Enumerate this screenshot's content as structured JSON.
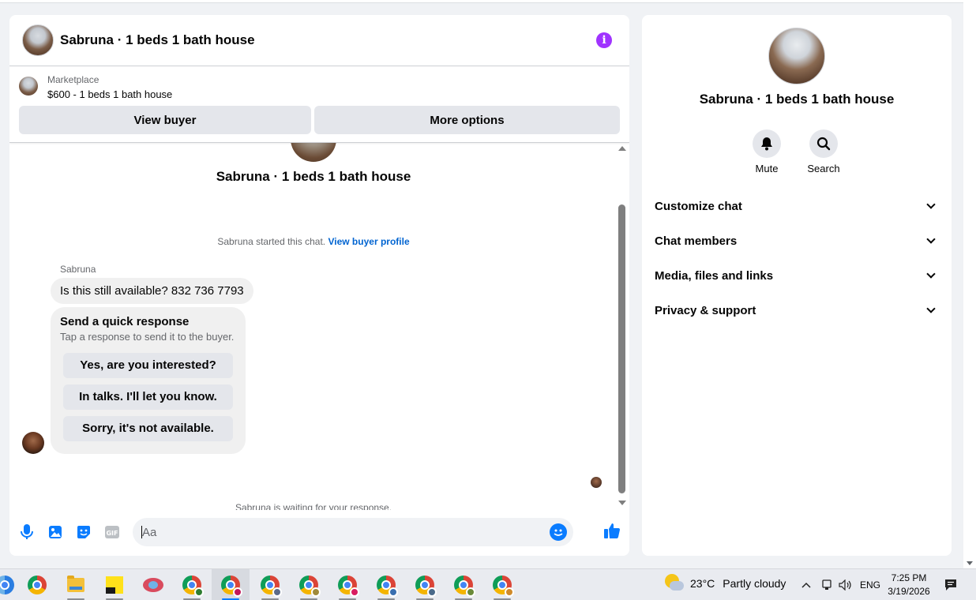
{
  "chat": {
    "header_title": "Sabruna · 1 beds 1 bath house",
    "marketplace": {
      "label": "Marketplace",
      "price_line": "$600 - 1 beds 1 bath house",
      "view_buyer": "View buyer",
      "more_options": "More options"
    },
    "conversation_title": "Sabruna · 1 beds 1 bath house",
    "system_started": "Sabruna started this chat.",
    "view_buyer_profile": "View buyer profile",
    "sender_name": "Sabruna",
    "message_text": "Is this still available? 832 736 7793",
    "quick_response": {
      "title": "Send a quick response",
      "subtitle": "Tap a response to send it to the buyer.",
      "options": [
        "Yes, are you interested?",
        "In talks. I'll let you know.",
        "Sorry, it's not available."
      ]
    },
    "waiting_text": "Sabruna is waiting for your response.",
    "composer_placeholder": "Aa"
  },
  "info_panel": {
    "name": "Sabruna · 1 beds 1 bath house",
    "actions": {
      "mute": "Mute",
      "search": "Search"
    },
    "sections": [
      "Customize chat",
      "Chat members",
      "Media, files and links",
      "Privacy & support"
    ]
  },
  "taskbar": {
    "weather_temp": "23°C",
    "weather_text": "Partly cloudy",
    "language": "ENG",
    "time": "7:25 PM",
    "date": "3/19/2026"
  },
  "colors": {
    "accent_blue": "#0a7cff",
    "link_blue": "#0064d1",
    "info_purple": "#a033ff"
  }
}
